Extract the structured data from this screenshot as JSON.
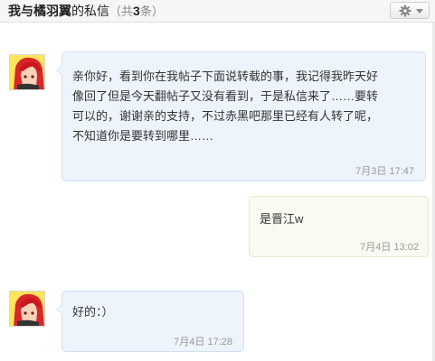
{
  "header": {
    "title_prefix": "我与",
    "contact_name": "橘羽翼",
    "title_mid": "的私信",
    "count_open": "（共",
    "count_value": "3",
    "count_close": "条）",
    "settings_icon": "gear-icon",
    "dropdown_icon": "caret-down-icon"
  },
  "messages": [
    {
      "sender": "them",
      "lines": [
        "亲你好，看到你在我帖子下面说转载的事，我记得我昨天好",
        "像回了但是今天翻帖子又没有看到，于是私信来了……要转",
        "可以的，谢谢亲的支持，不过赤黑吧那里已经有人转了呢，",
        "不知道你是要转到哪里……"
      ],
      "time": "7月3日 17:47"
    },
    {
      "sender": "me",
      "lines": [
        "是晋江w"
      ],
      "time": "7月4日 13:02"
    },
    {
      "sender": "them",
      "lines": [
        "好的：）"
      ],
      "time": "7月4日 17:28"
    }
  ],
  "colors": {
    "their_bubble": "#eef4fb",
    "their_border": "#cfe0f1",
    "my_bubble": "#fafaf2",
    "my_border": "#e6e6cc",
    "time_text": "#999999"
  }
}
